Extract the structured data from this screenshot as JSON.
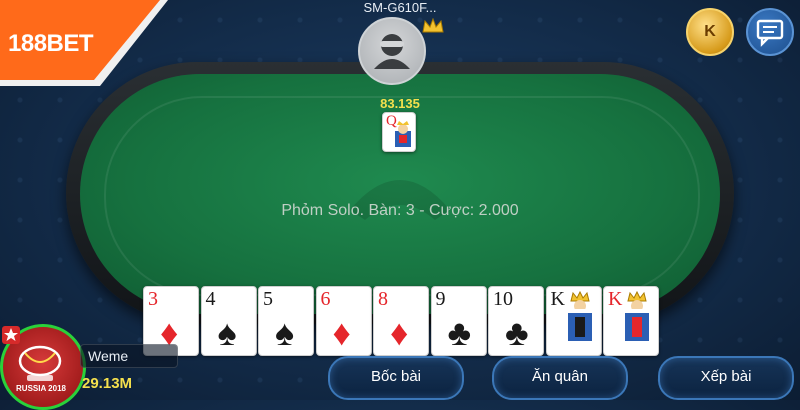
{
  "brand": {
    "logo_num": "188",
    "logo_bet": "BET"
  },
  "opponent": {
    "name": "SM-G610F...",
    "money": "83.135",
    "card": {
      "rank": "Q",
      "suit": "♦",
      "color": "red"
    }
  },
  "table": {
    "info": "Phỏm Solo. Bàn: 3 - Cược: 2.000"
  },
  "hand": [
    {
      "rank": "3",
      "suit": "♦",
      "color": "red"
    },
    {
      "rank": "4",
      "suit": "♠",
      "color": "black"
    },
    {
      "rank": "5",
      "suit": "♠",
      "color": "black"
    },
    {
      "rank": "6",
      "suit": "♦",
      "color": "red"
    },
    {
      "rank": "8",
      "suit": "♦",
      "color": "red"
    },
    {
      "rank": "9",
      "suit": "♣",
      "color": "black"
    },
    {
      "rank": "10",
      "suit": "♣",
      "color": "black"
    },
    {
      "rank": "K",
      "suit": "♠",
      "color": "black"
    },
    {
      "rank": "K",
      "suit": "♦",
      "color": "red"
    }
  ],
  "player": {
    "name": "Weme",
    "money": "29.13M",
    "badge": "RUSSIA 2018"
  },
  "top_buttons": {
    "coin_label": "K",
    "coin_icon": "coin-icon",
    "chat_icon": "chat-icon"
  },
  "actions": {
    "draw": "Bốc bài",
    "eat": "Ăn quân",
    "arrange": "Xếp bài"
  },
  "colors": {
    "felt": "#16713f",
    "accent": "#3b77b8",
    "money": "#f4e04d",
    "logo_bg": "#ff6a1a"
  }
}
